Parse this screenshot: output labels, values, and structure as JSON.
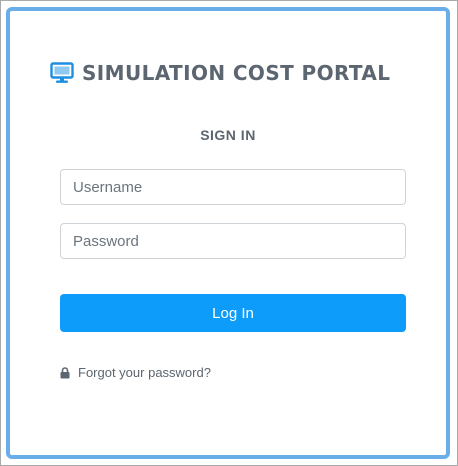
{
  "login": {
    "brand": {
      "title": "SIMULATION COST PORTAL",
      "icon": "monitor-icon",
      "icon_color": "#1e8ee0"
    },
    "subtitle": "SIGN IN",
    "username": {
      "placeholder": "Username",
      "value": ""
    },
    "password": {
      "placeholder": "Password",
      "value": ""
    },
    "submit_label": "Log In",
    "forgot": {
      "icon": "lock-icon",
      "label": "Forgot your password?"
    }
  },
  "colors": {
    "card_border": "#6aaee9",
    "button": "#0d9cf9",
    "text": "#5c6670"
  }
}
